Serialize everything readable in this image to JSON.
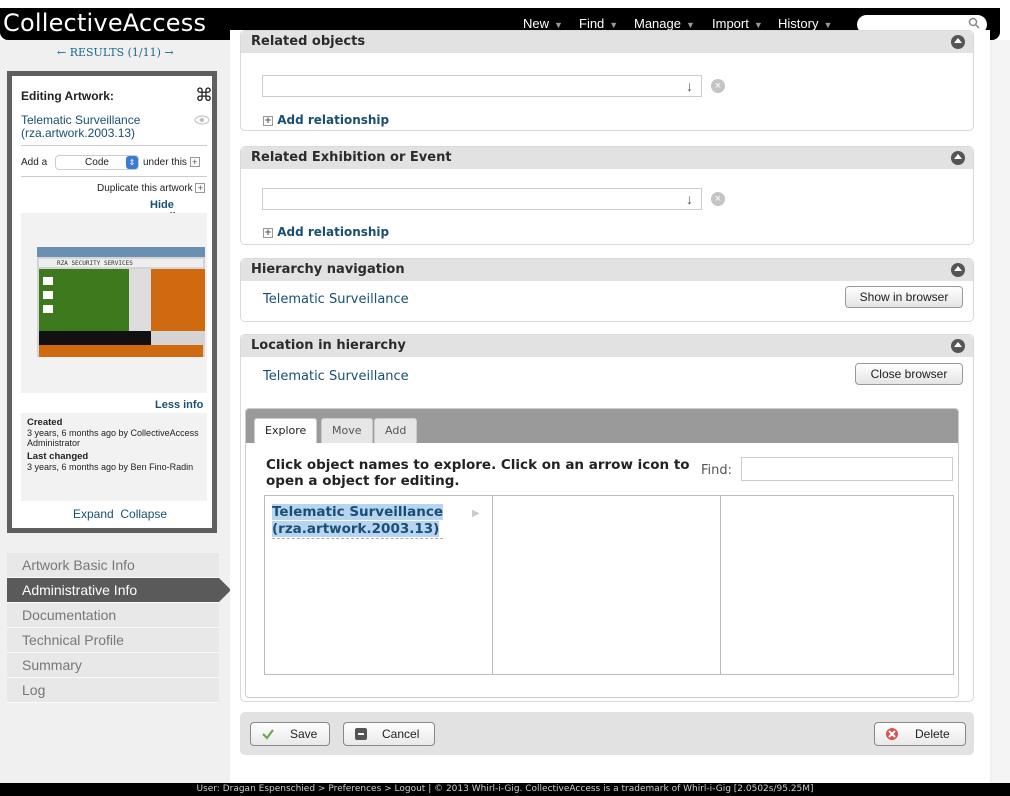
{
  "app": {
    "logo": "CollectiveAccess"
  },
  "topnav": {
    "items": [
      {
        "label": "New"
      },
      {
        "label": "Find"
      },
      {
        "label": "Manage"
      },
      {
        "label": "Import"
      },
      {
        "label": "History"
      }
    ],
    "search_placeholder": ""
  },
  "results_nav": "← RESULTS (1/11) →",
  "inspector": {
    "title": "Editing Artwork:",
    "name_line1": "Telematic Surveillance",
    "name_line2": "(rza.artwork.2003.13)",
    "add_a": "Add a",
    "select_value": "Code",
    "under_this": "under this",
    "duplicate": "Duplicate this artwork",
    "hide_media": "Hide media ›",
    "less_info": "Less info ›",
    "created_label": "Created",
    "created_text": "3 years, 6 months ago by CollectiveAccess Administrator",
    "changed_label": "Last changed",
    "changed_text": "3 years, 6 months ago by Ben Fino-Radin",
    "expand": "Expand",
    "collapse": "Collapse"
  },
  "leftnav": {
    "items": [
      {
        "label": "Artwork Basic Info"
      },
      {
        "label": "Administrative Info"
      },
      {
        "label": "Documentation"
      },
      {
        "label": "Technical Profile"
      },
      {
        "label": "Summary"
      },
      {
        "label": "Log"
      }
    ],
    "active": "Administrative Info"
  },
  "panels": {
    "related_objects": {
      "title": "Related objects",
      "add": "Add relationship"
    },
    "related_exhibition": {
      "title": "Related Exhibition or Event",
      "add": "Add relationship"
    },
    "hierarchy_nav": {
      "title": "Hierarchy navigation",
      "link": "Telematic Surveillance",
      "button": "Show in browser"
    },
    "location": {
      "title": "Location in hierarchy",
      "link": "Telematic Surveillance",
      "button": "Close browser"
    }
  },
  "browser": {
    "tabs": [
      {
        "label": "Explore"
      },
      {
        "label": "Move"
      },
      {
        "label": "Add"
      }
    ],
    "instructions": "Click object names to explore. Click on an arrow icon to open a object for editing.",
    "find_label": "Find:",
    "item_line1": "Telematic Surveillance",
    "item_line2": "(rza.artwork.2003.13)"
  },
  "actions": {
    "save": "Save",
    "cancel": "Cancel",
    "delete": "Delete"
  },
  "footer": "User: Dragan Espenschied > Preferences > Logout  |  © 2013 Whirl-i-Gig. CollectiveAccess is a trademark of Whirl-i-Gig [2.0502s/95.25M]"
}
